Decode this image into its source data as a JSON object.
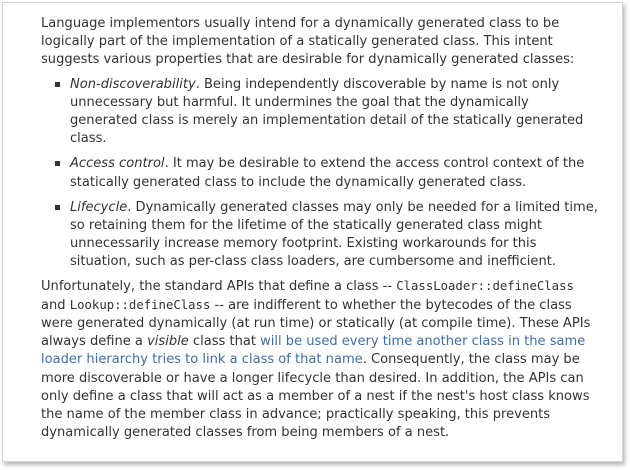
{
  "document": {
    "intro": "Language implementors usually intend for a dynamically generated class to be logically part of the implementation of a statically generated class. This intent suggests various properties that are desirable for dynamically generated classes:",
    "items": [
      {
        "term": "Non-discoverability",
        "text": ". Being independently discoverable by name is not only unnecessary but harmful. It undermines the goal that the dynamically generated class is merely an implementation detail of the statically generated class."
      },
      {
        "term": "Access control",
        "text": ". It may be desirable to extend the access control context of the statically generated class to include the dynamically generated class."
      },
      {
        "term": "Lifecycle",
        "text": ". Dynamically generated classes may only be needed for a limited time, so retaining them for the lifetime of the statically generated class might unnecessarily increase memory footprint. Existing workarounds for this situation, such as per-class class loaders, are cumbersome and inefficient."
      }
    ],
    "final": {
      "part1": "Unfortunately, the standard APIs that define a class -- ",
      "code1": "ClassLoader::defineClass",
      "part2": " and ",
      "code2": "Lookup::defineClass",
      "part3": " -- are indifferent to whether the bytecodes of the class were generated dynamically (at run time) or statically (at compile time). These APIs always define a ",
      "visible": "visible",
      "part4": " class that ",
      "link": "will be used every time another class in the same loader hierarchy tries to link a class of that name",
      "part5": ". Consequently, the class may be more discoverable or have a longer lifecycle than desired. In addition, the APIs can only define a class that will act as a member of a nest if the nest's host class knows the name of the member class in advance; practically speaking, this prevents dynamically generated classes from being members of a nest."
    }
  },
  "colors": {
    "text": "#333333",
    "link": "#3d6fa5",
    "border": "#d4d4d4"
  }
}
